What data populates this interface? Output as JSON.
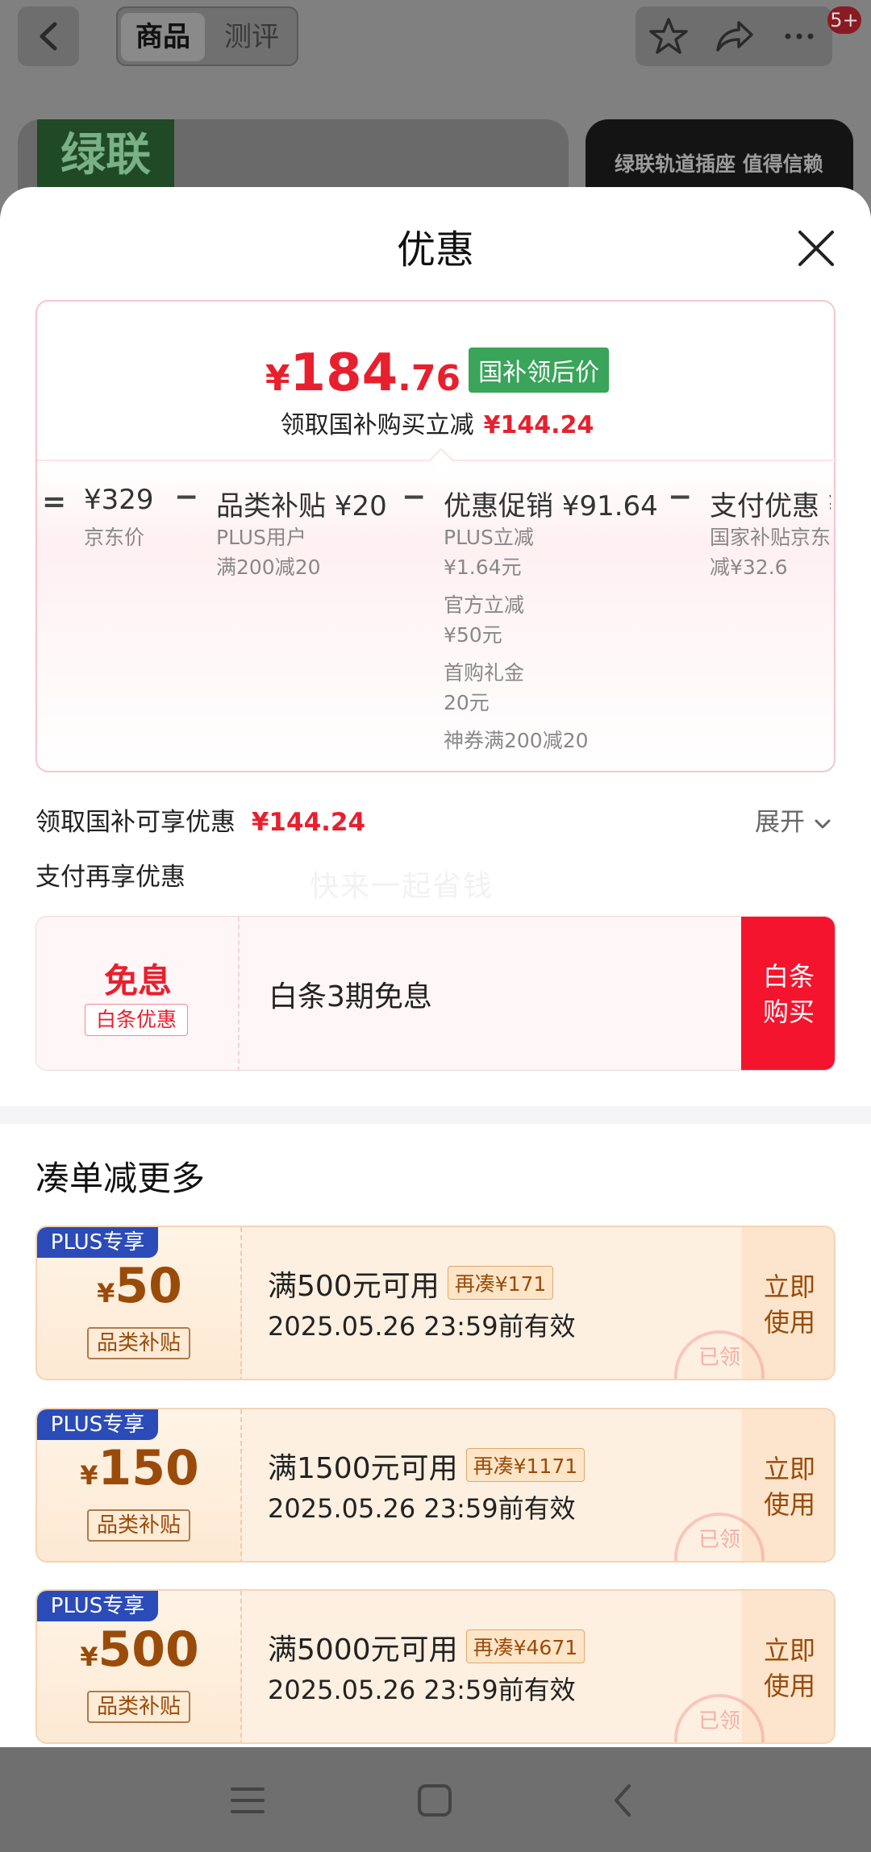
{
  "header": {
    "tabs": [
      {
        "label": "商品"
      },
      {
        "label": "测评"
      }
    ],
    "notification_badge": "5+"
  },
  "background": {
    "brand_logo_text": "绿联",
    "promo_card_text": "绿联轨道插座 值得信赖"
  },
  "sheet": {
    "title": "优惠",
    "final_price": {
      "yen": "¥",
      "integer": "184",
      "decimal": ".76",
      "tag": "国补领后价"
    },
    "subsidy_line": {
      "text": "领取国补购买立减",
      "amount": "¥144.24"
    },
    "breakdown": [
      {
        "operator": "=",
        "title": "¥329",
        "lines": [
          "京东价"
        ]
      },
      {
        "operator": "−",
        "title": "品类补贴 ¥20",
        "lines": [
          "PLUS用户",
          "满200减20"
        ]
      },
      {
        "operator": "−",
        "title": "优惠促销 ¥91.64",
        "lines": [
          "PLUS立减",
          "¥1.64元",
          "官方立减",
          "¥50元",
          "首购礼金",
          "20元",
          "神券满200减20"
        ]
      },
      {
        "operator": "−",
        "title": "支付优惠 ¥",
        "lines": [
          "国家补贴京东",
          "减¥32.6"
        ]
      }
    ],
    "guobu_row": {
      "label": "领取国补可享优惠",
      "amount": "¥144.24",
      "expand": "展开"
    },
    "pay_row": {
      "label": "支付再享优惠"
    },
    "watermark": "快来一起省钱",
    "baitiao": {
      "badge_title": "免息",
      "badge_tag": "白条优惠",
      "text": "白条3期免息",
      "buy_button": "白条购买"
    },
    "more_section": {
      "title": "凑单减更多"
    },
    "coupons": [
      {
        "plus_tag": "PLUS专享",
        "yen": "¥",
        "amount": "50",
        "category": "品类补贴",
        "condition": "满500元可用",
        "extra": "再凑¥171",
        "validity": "2025.05.26 23:59前有效",
        "use_button": "立即使用",
        "stamp": "已领"
      },
      {
        "plus_tag": "PLUS专享",
        "yen": "¥",
        "amount": "150",
        "category": "品类补贴",
        "condition": "满1500元可用",
        "extra": "再凑¥1171",
        "validity": "2025.05.26 23:59前有效",
        "use_button": "立即使用",
        "stamp": "已领"
      },
      {
        "plus_tag": "PLUS专享",
        "yen": "¥",
        "amount": "500",
        "category": "品类补贴",
        "condition": "满5000元可用",
        "extra": "再凑¥4671",
        "validity": "2025.05.26 23:59前有效",
        "use_button": "立即使用",
        "stamp": "已领"
      }
    ]
  },
  "colors": {
    "accent_red": "#e8202e",
    "subsidy_green": "#3aa45a",
    "plus_blue": "#2b4bb8",
    "coupon_brown": "#9a4b0a"
  },
  "icons": [
    "back-icon",
    "star-icon",
    "share-icon",
    "more-icon",
    "close-icon",
    "chevron-down-icon",
    "menu-icon",
    "home-icon",
    "nav-back-icon"
  ]
}
